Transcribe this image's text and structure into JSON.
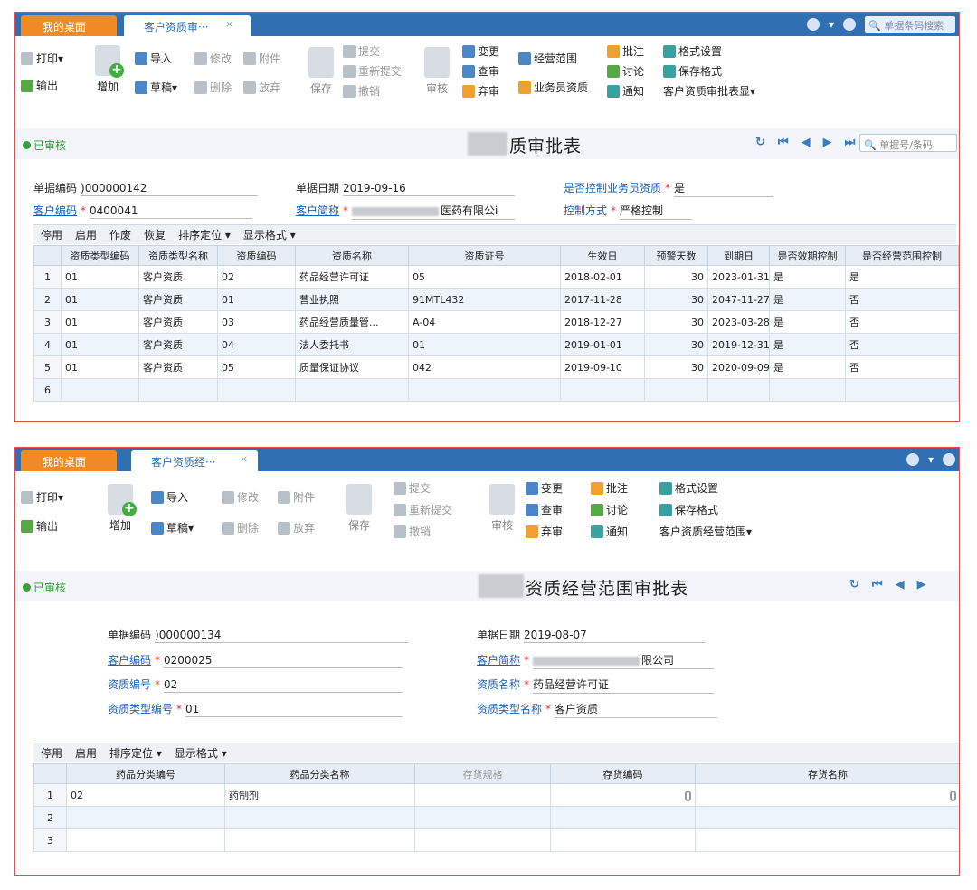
{
  "panel1": {
    "tab_home": "我的桌面",
    "tab_active": "客户资质审···",
    "tab_close": "×",
    "tb_search": "单据条码搜索",
    "toolbar": {
      "print": "打印",
      "export": "输出",
      "add": "增加",
      "import": "导入",
      "edit": "修改",
      "attach": "附件",
      "draft": "草稿",
      "delete": "删除",
      "discard": "放弃",
      "save": "保存",
      "submit": "提交",
      "resubmit": "重新提交",
      "revoke": "撤销",
      "audit": "审核",
      "change": "变更",
      "check": "查审",
      "abandon": "弃审",
      "scope": "经营范围",
      "salesman": "业务员资质",
      "annotate": "批注",
      "discuss": "讨论",
      "notify": "通知",
      "format_settings": "格式设置",
      "save_format": "保存格式",
      "display_dropdown": "客户资质审批表显"
    },
    "status": "已审核",
    "title": "质审批表",
    "search_placeholder": "单据号/条码",
    "form": {
      "doc_no_label": "单据编码",
      "doc_no": ")000000142",
      "doc_date_label": "单据日期",
      "doc_date": "2019-09-16",
      "ctrl_label": "是否控制业务员资质",
      "ctrl_value": "是",
      "cust_code_label": "客户编码",
      "cust_code": "0400041",
      "cust_name_label": "客户简称",
      "cust_name_suffix": "医药有限公i",
      "ctrl_mode_label": "控制方式",
      "ctrl_mode": "严格控制"
    },
    "table_toolbar": [
      "停用",
      "启用",
      "作废",
      "恢复",
      "排序定位 ▾",
      "显示格式 ▾"
    ],
    "columns": [
      "资质类型编码",
      "资质类型名称",
      "资质编码",
      "资质名称",
      "资质证号",
      "生效日",
      "预警天数",
      "到期日",
      "是否效期控制",
      "是否经营范围控制"
    ],
    "rows": [
      {
        "idx": "1",
        "c1": "01",
        "c2": "客户资质",
        "c3": "02",
        "c4": "药品经营许可证",
        "c5": "05",
        "c6": "2018-02-01",
        "c7": "30",
        "c8": "2023-01-31",
        "c9": "是",
        "c10": "是"
      },
      {
        "idx": "2",
        "c1": "01",
        "c2": "客户资质",
        "c3": "01",
        "c4": "营业执照",
        "c5": "91MTL432",
        "c6": "2017-11-28",
        "c7": "30",
        "c8": "2047-11-27",
        "c9": "是",
        "c10": "否"
      },
      {
        "idx": "3",
        "c1": "01",
        "c2": "客户资质",
        "c3": "03",
        "c4": "药品经营质量管...",
        "c5": "A-04",
        "c6": "2018-12-27",
        "c7": "30",
        "c8": "2023-03-28",
        "c9": "是",
        "c10": "否"
      },
      {
        "idx": "4",
        "c1": "01",
        "c2": "客户资质",
        "c3": "04",
        "c4": "法人委托书",
        "c5": "01",
        "c6": "2019-01-01",
        "c7": "30",
        "c8": "2019-12-31",
        "c9": "是",
        "c10": "否"
      },
      {
        "idx": "5",
        "c1": "01",
        "c2": "客户资质",
        "c3": "05",
        "c4": "质量保证协议",
        "c5": "042",
        "c6": "2019-09-10",
        "c7": "30",
        "c8": "2020-09-09",
        "c9": "是",
        "c10": "否"
      },
      {
        "idx": "6",
        "c1": "",
        "c2": "",
        "c3": "",
        "c4": "",
        "c5": "",
        "c6": "",
        "c7": "",
        "c8": "",
        "c9": "",
        "c10": ""
      }
    ]
  },
  "panel2": {
    "tab_home": "我的桌面",
    "tab_active": "客户资质经···",
    "tab_close": "×",
    "toolbar": {
      "print": "打印",
      "export": "输出",
      "add": "增加",
      "import": "导入",
      "edit": "修改",
      "attach": "附件",
      "draft": "草稿",
      "delete": "删除",
      "discard": "放弃",
      "save": "保存",
      "submit": "提交",
      "resubmit": "重新提交",
      "revoke": "撤销",
      "audit": "审核",
      "change": "变更",
      "check": "查审",
      "abandon": "弃审",
      "annotate": "批注",
      "discuss": "讨论",
      "notify": "通知",
      "format_settings": "格式设置",
      "save_format": "保存格式",
      "display_dropdown": "客户资质经营范围"
    },
    "status": "已审核",
    "title": "资质经营范围审批表",
    "form": {
      "doc_no_label": "单据编码",
      "doc_no": ")000000134",
      "doc_date_label": "单据日期",
      "doc_date": "2019-08-07",
      "cust_code_label": "客户编码",
      "cust_code": "0200025",
      "cust_name_label": "客户简称",
      "cust_name_suffix": "限公司",
      "qual_no_label": "资质编号",
      "qual_no": "02",
      "qual_name_label": "资质名称",
      "qual_name": "药品经营许可证",
      "qual_type_no_label": "资质类型编号",
      "qual_type_no": "01",
      "qual_type_name_label": "资质类型名称",
      "qual_type_name": "客户资质"
    },
    "table_toolbar": [
      "停用",
      "启用",
      "排序定位 ▾",
      "显示格式 ▾"
    ],
    "columns": [
      "药品分类编号",
      "药品分类名称",
      "存货规格",
      "存货编码",
      "存货名称"
    ],
    "rows": [
      {
        "idx": "1",
        "c1": "02",
        "c2": "药制剂",
        "c3": "",
        "c4": "",
        "c5": ""
      },
      {
        "idx": "2",
        "c1": "",
        "c2": "",
        "c3": "",
        "c4": "",
        "c5": ""
      },
      {
        "idx": "3",
        "c1": "",
        "c2": "",
        "c3": "",
        "c4": "",
        "c5": ""
      }
    ]
  }
}
